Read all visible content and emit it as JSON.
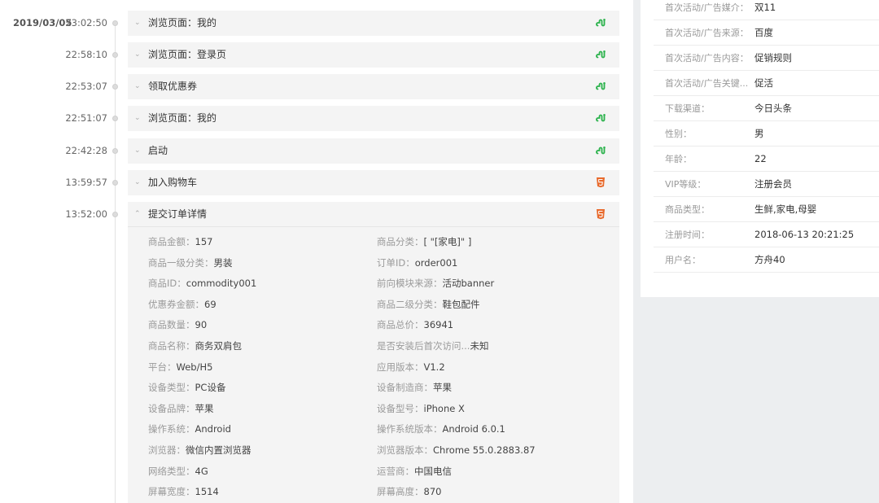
{
  "timeline": {
    "date": "2019/03/05",
    "events": [
      {
        "time": "23:02:50",
        "title": "浏览页面：我的",
        "icon": "miniprogram-icon",
        "expanded": false
      },
      {
        "time": "22:58:10",
        "title": "浏览页面：登录页",
        "icon": "miniprogram-icon",
        "expanded": false
      },
      {
        "time": "22:53:07",
        "title": "领取优惠券",
        "icon": "miniprogram-icon",
        "expanded": false
      },
      {
        "time": "22:51:07",
        "title": "浏览页面：我的",
        "icon": "miniprogram-icon",
        "expanded": false
      },
      {
        "time": "22:42:28",
        "title": "启动",
        "icon": "miniprogram-icon",
        "expanded": false
      },
      {
        "time": "13:59:57",
        "title": "加入购物车",
        "icon": "html5-icon",
        "expanded": false
      },
      {
        "time": "13:52:00",
        "title": "提交订单详情",
        "icon": "html5-icon",
        "expanded": true
      }
    ],
    "details": {
      "left": [
        {
          "key": "商品金额：",
          "value": "157"
        },
        {
          "key": "商品一级分类：",
          "value": "男装"
        },
        {
          "key": "商品ID：",
          "value": "commodity001"
        },
        {
          "key": "优惠券金额：",
          "value": "69"
        },
        {
          "key": "商品数量：",
          "value": "90"
        },
        {
          "key": "商品名称：",
          "value": "商务双肩包"
        },
        {
          "key": "平台：",
          "value": "Web/H5"
        },
        {
          "key": "设备类型：",
          "value": "PC设备"
        },
        {
          "key": "设备品牌：",
          "value": "苹果"
        },
        {
          "key": "操作系统：",
          "value": "Android"
        },
        {
          "key": "浏览器：",
          "value": "微信内置浏览器"
        },
        {
          "key": "网络类型：",
          "value": "4G"
        },
        {
          "key": "屏幕宽度：",
          "value": "1514"
        }
      ],
      "right": [
        {
          "key": "商品分类：",
          "value": "[ \"[家电]\" ]"
        },
        {
          "key": "订单ID：",
          "value": "order001"
        },
        {
          "key": "前向模块来源：",
          "value": "活动banner"
        },
        {
          "key": "商品二级分类：",
          "value": "鞋包配件"
        },
        {
          "key": "商品总价：",
          "value": "36941"
        },
        {
          "key": "是否安装后首次访问...",
          "value": "未知"
        },
        {
          "key": "应用版本：",
          "value": "V1.2"
        },
        {
          "key": "设备制造商：",
          "value": "苹果"
        },
        {
          "key": "设备型号：",
          "value": "iPhone X"
        },
        {
          "key": "操作系统版本：",
          "value": "Android 6.0.1"
        },
        {
          "key": "浏览器版本：",
          "value": "Chrome 55.0.2883.87"
        },
        {
          "key": "运营商：",
          "value": "中国电信"
        },
        {
          "key": "屏幕高度：",
          "value": "870"
        }
      ]
    }
  },
  "profile": [
    {
      "label": "首次活动/广告媒介：",
      "value": "双11"
    },
    {
      "label": "首次活动/广告来源：",
      "value": "百度"
    },
    {
      "label": "首次活动/广告内容：",
      "value": "促销规则"
    },
    {
      "label": "首次活动/广告关键...",
      "value": "促活"
    },
    {
      "label": "下载渠道：",
      "value": "今日头条"
    },
    {
      "label": "性别：",
      "value": "男"
    },
    {
      "label": "年龄：",
      "value": "22"
    },
    {
      "label": "VIP等级：",
      "value": "注册会员"
    },
    {
      "label": "商品类型：",
      "value": "生鲜,家电,母婴"
    },
    {
      "label": "注册时间：",
      "value": "2018-06-13 20:21:25"
    },
    {
      "label": "用户名：",
      "value": "方舟40"
    }
  ],
  "colors": {
    "miniprogram": "#2bb24c",
    "html5": "#e8692b"
  }
}
